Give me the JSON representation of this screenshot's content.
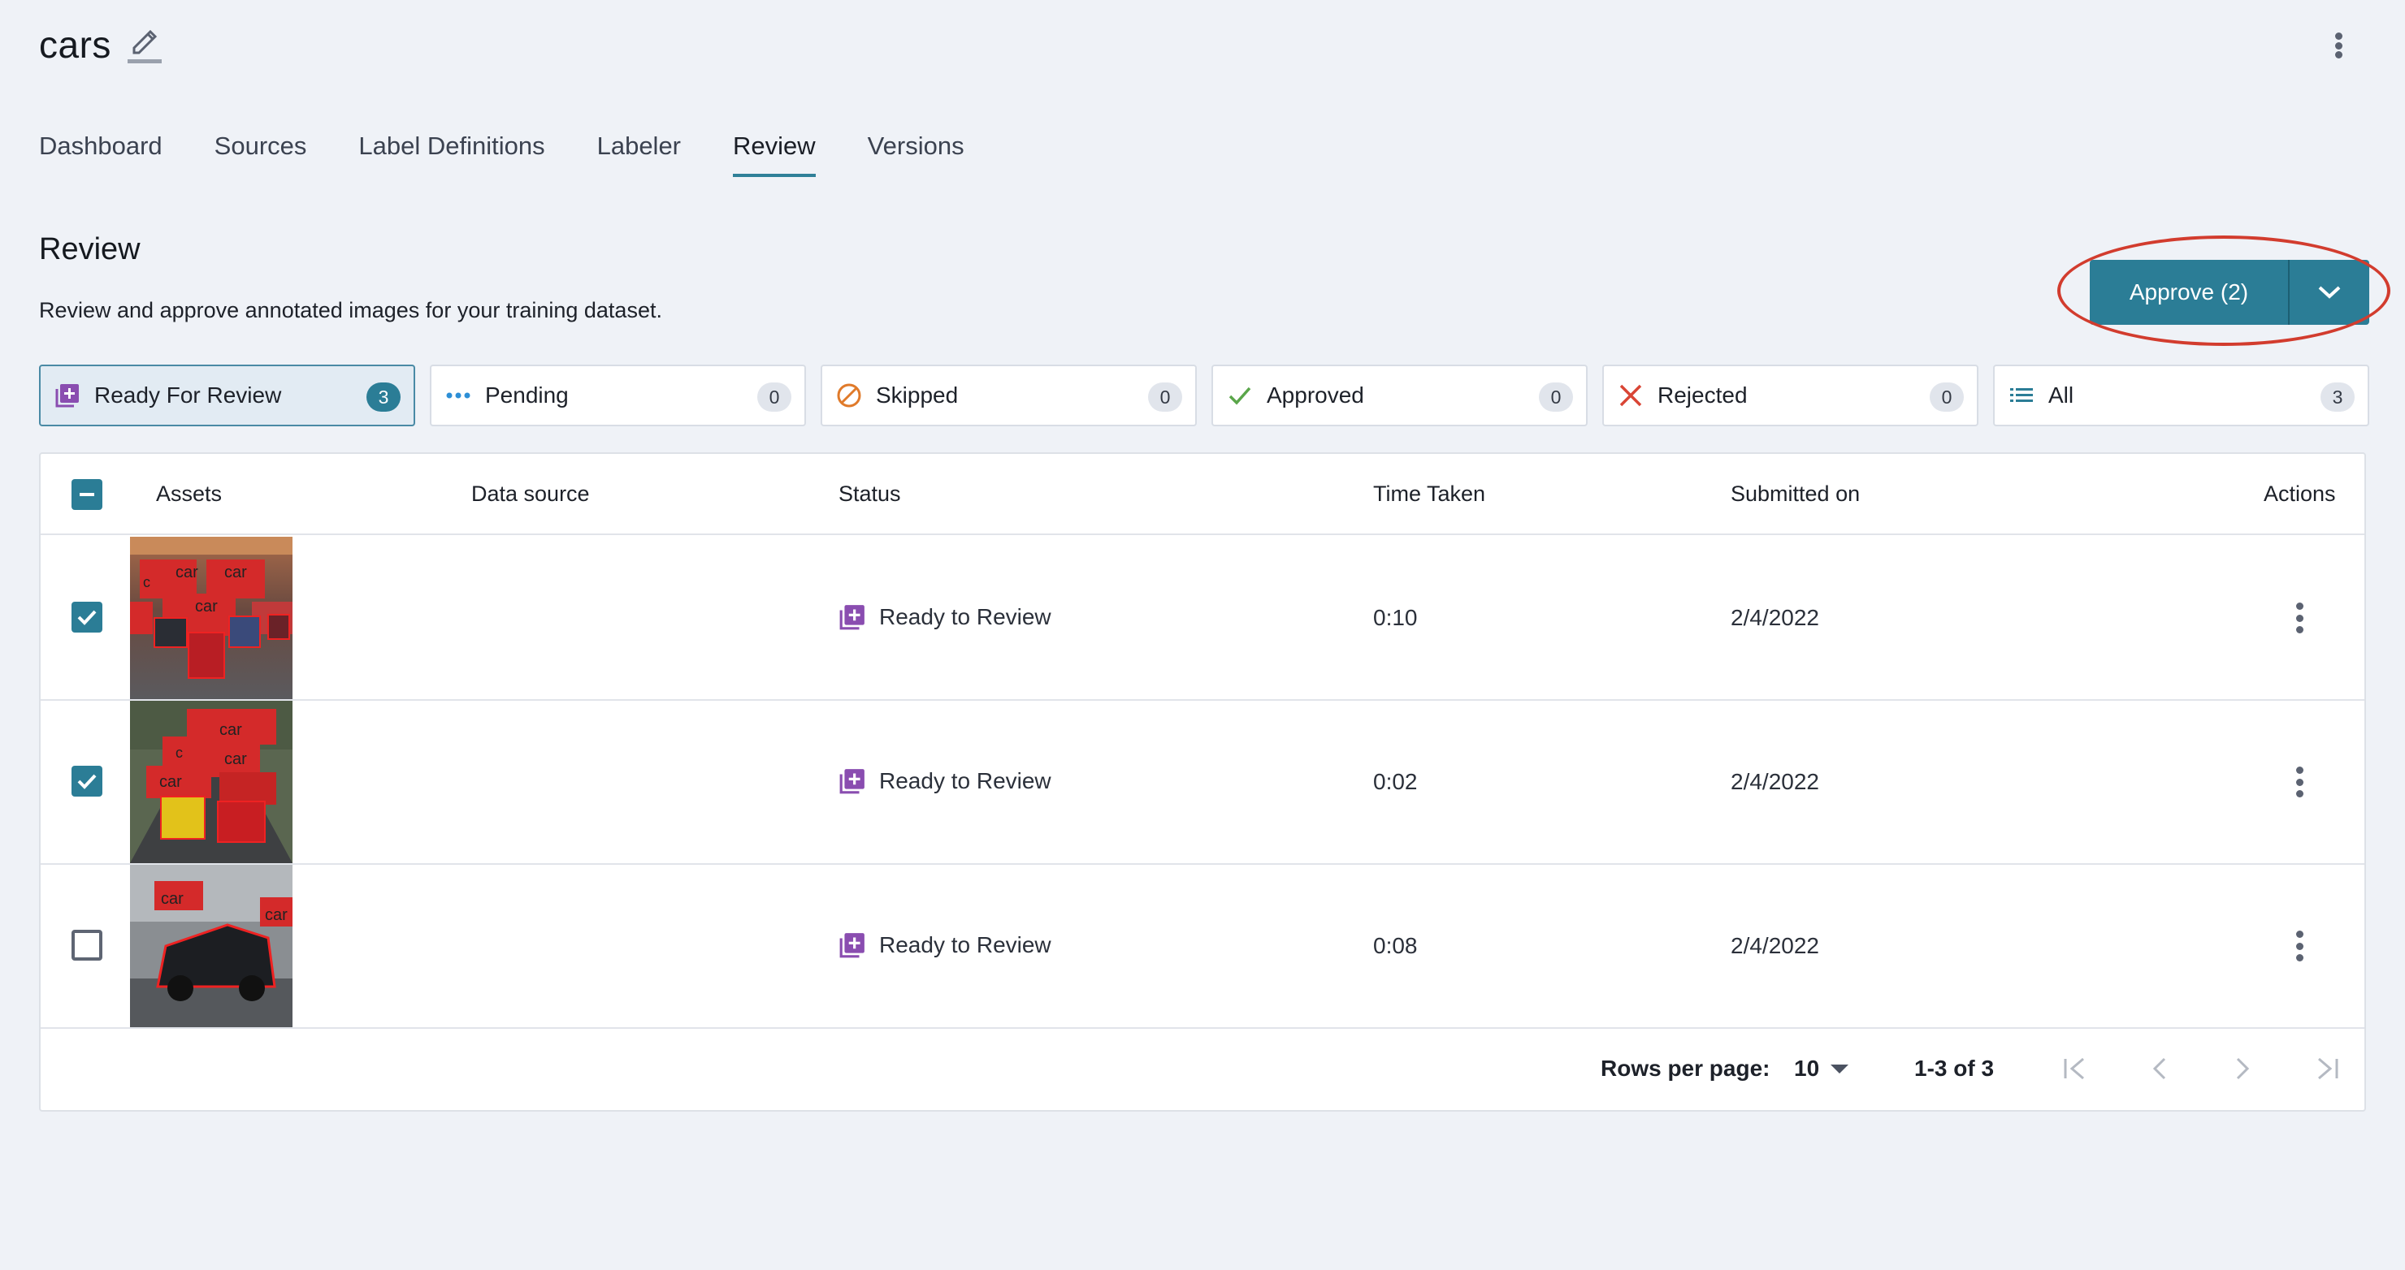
{
  "project": {
    "title": "cars"
  },
  "tabs": [
    {
      "label": "Dashboard",
      "active": false
    },
    {
      "label": "Sources",
      "active": false
    },
    {
      "label": "Label Definitions",
      "active": false
    },
    {
      "label": "Labeler",
      "active": false
    },
    {
      "label": "Review",
      "active": true
    },
    {
      "label": "Versions",
      "active": false
    }
  ],
  "section": {
    "title": "Review",
    "description": "Review and approve annotated images for your training dataset."
  },
  "approve": {
    "label": "Approve (2)"
  },
  "filters": [
    {
      "label": "Ready For Review",
      "count": "3",
      "icon": "ready-review-icon",
      "active": true
    },
    {
      "label": "Pending",
      "count": "0",
      "icon": "pending-dots-icon",
      "active": false
    },
    {
      "label": "Skipped",
      "count": "0",
      "icon": "skipped-icon",
      "active": false
    },
    {
      "label": "Approved",
      "count": "0",
      "icon": "check-icon",
      "active": false
    },
    {
      "label": "Rejected",
      "count": "0",
      "icon": "x-icon",
      "active": false
    },
    {
      "label": "All",
      "count": "3",
      "icon": "list-icon",
      "active": false
    }
  ],
  "table": {
    "columns": {
      "assets": "Assets",
      "data_source": "Data source",
      "status": "Status",
      "time_taken": "Time Taken",
      "submitted_on": "Submitted on",
      "actions": "Actions"
    },
    "rows": [
      {
        "checked": true,
        "data_source": "",
        "status": "Ready to Review",
        "time_taken": "0:10",
        "submitted_on": "2/4/2022",
        "thumb_labels": [
          "car",
          "car",
          "car",
          "c"
        ]
      },
      {
        "checked": true,
        "data_source": "",
        "status": "Ready to Review",
        "time_taken": "0:02",
        "submitted_on": "2/4/2022",
        "thumb_labels": [
          "car",
          "car",
          "car",
          "c"
        ]
      },
      {
        "checked": false,
        "data_source": "",
        "status": "Ready to Review",
        "time_taken": "0:08",
        "submitted_on": "2/4/2022",
        "thumb_labels": [
          "car",
          "car"
        ]
      }
    ]
  },
  "pagination": {
    "rows_per_page_label": "Rows per page:",
    "rows_per_page_value": "10",
    "range": "1-3 of 3"
  },
  "colors": {
    "accent": "#2b7d96",
    "annotation_red": "#d23c2e",
    "status_purple": "#8a4db0"
  }
}
